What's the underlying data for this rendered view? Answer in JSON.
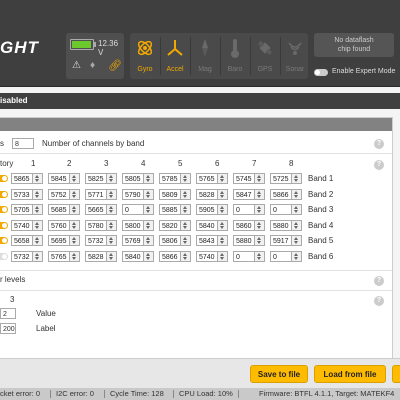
{
  "header": {
    "logo_text": "GHT",
    "voltage": "12.36 V",
    "battery_color": "#6cc92c",
    "sensors": [
      {
        "label": "Gyro",
        "active": true,
        "icon": "gyro-icon"
      },
      {
        "label": "Accel",
        "active": true,
        "icon": "accel-icon"
      },
      {
        "label": "Mag",
        "active": false,
        "icon": "mag-icon"
      },
      {
        "label": "Baro",
        "active": false,
        "icon": "baro-icon"
      },
      {
        "label": "GPS",
        "active": false,
        "icon": "gps-icon"
      },
      {
        "label": "Sonar",
        "active": false,
        "icon": "sonar-icon"
      }
    ],
    "dataflash_line1": "No dataflash",
    "dataflash_line2": "chip found",
    "expert_mode_label": "Enable Expert Mode"
  },
  "subbar": {
    "text": "isabled"
  },
  "vtx_table": {
    "bands_label": "s",
    "bands_count": "8",
    "channels_label": "Number of channels by band",
    "factory_header": "tory",
    "channel_headers": [
      "1",
      "2",
      "3",
      "4",
      "5",
      "6",
      "7",
      "8"
    ],
    "rows": [
      {
        "factory_on": true,
        "values": [
          "5865",
          "5845",
          "5825",
          "5805",
          "5785",
          "5765",
          "5745",
          "5725"
        ],
        "band": "Band 1"
      },
      {
        "factory_on": true,
        "values": [
          "5733",
          "5752",
          "5771",
          "5790",
          "5809",
          "5828",
          "5847",
          "5866"
        ],
        "band": "Band 2"
      },
      {
        "factory_on": true,
        "values": [
          "5705",
          "5685",
          "5665",
          "0",
          "5885",
          "5905",
          "0",
          "0"
        ],
        "band": "Band 3"
      },
      {
        "factory_on": true,
        "values": [
          "5740",
          "5760",
          "5780",
          "5800",
          "5820",
          "5840",
          "5860",
          "5880"
        ],
        "band": "Band 4"
      },
      {
        "factory_on": true,
        "values": [
          "5658",
          "5695",
          "5732",
          "5769",
          "5806",
          "5843",
          "5880",
          "5917"
        ],
        "band": "Band 5"
      },
      {
        "factory_on": false,
        "values": [
          "5732",
          "5765",
          "5828",
          "5840",
          "5866",
          "5740",
          "0",
          "0"
        ],
        "band": "Band 6"
      }
    ],
    "power_levels_label": "r levels",
    "power_col_header": "3",
    "power_value": "2",
    "power_value_label": "Value",
    "power_label_value": "200",
    "power_label_label": "Label"
  },
  "buttons": {
    "save_file": "Save to file",
    "load_file": "Load from file"
  },
  "status": {
    "packet_error": "cket error: 0",
    "i2c_error": "I2C error: 0",
    "cycle_time": "Cycle Time: 128",
    "cpu_load": "CPU Load: 10%",
    "firmware": "Firmware: BTFL 4.1.1, Target: MATEKF4"
  },
  "colors": {
    "accent": "#ffbb00",
    "header_bg": "#3f3f3f",
    "sensor_active": "#f2a900"
  }
}
